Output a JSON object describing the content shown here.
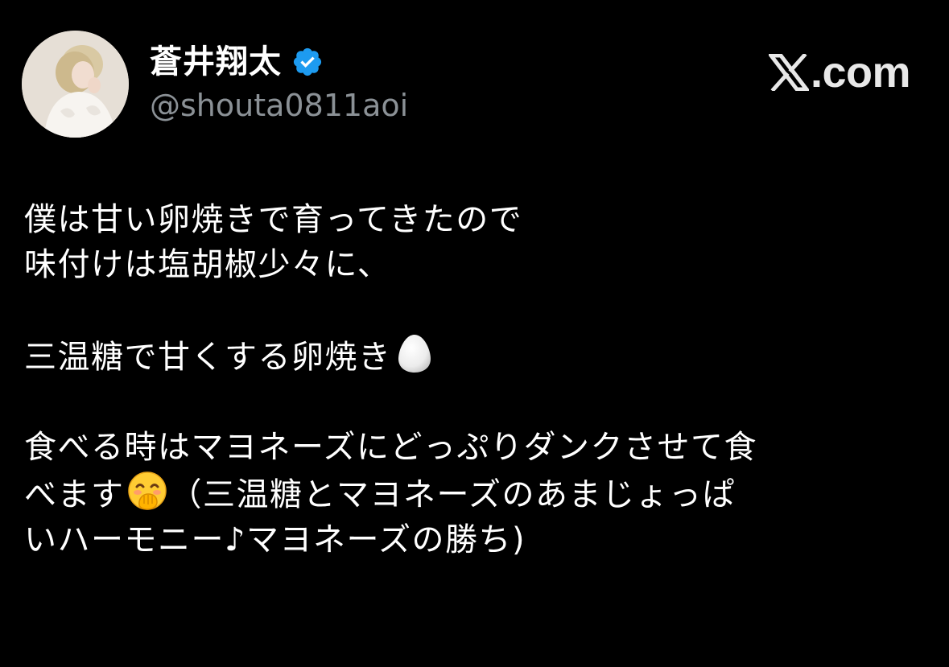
{
  "author": {
    "display_name": "蒼井翔太",
    "handle": "@shouta0811aoi",
    "verified": true,
    "avatar_icon": "profile-photo"
  },
  "brand": {
    "logo_icon": "x-logo-icon",
    "label": ".com",
    "full_label": "X.com"
  },
  "tweet": {
    "line1": "僕は甘い卵焼きで育ってきたので",
    "line2": "味付けは塩胡椒少々に、",
    "line3_text": "三温糖で甘くする卵焼き",
    "line3_emoji": "egg-icon",
    "line4": "食べる時はマヨネーズにどっぷりダンクさせて食",
    "line5_text_before": "べます",
    "line5_emoji": "face-with-hand-over-mouth-icon",
    "line5_text_after": "（三温糖とマヨネーズのあまじょっぱ",
    "line6": "いハーモニー♪マヨネーズの勝ち)"
  },
  "colors": {
    "background": "#000000",
    "text": "#ffffff",
    "secondary_text": "#8b9196",
    "verified_blue": "#1d9bf0"
  }
}
